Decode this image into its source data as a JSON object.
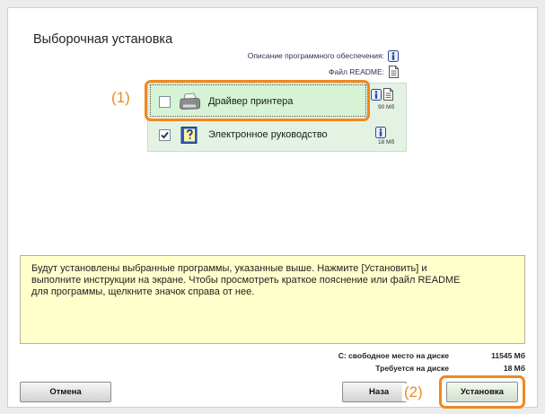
{
  "window": {
    "title": "Выборочная установка"
  },
  "legend": {
    "description_label": "Описание программного обеспечения:",
    "description_icon": "info-icon",
    "readme_label": "Файл README:",
    "readme_icon": "readme-icon"
  },
  "components": [
    {
      "name": "Драйвер принтера",
      "size": "90 Мб",
      "checked": false,
      "icon": "printer-icon",
      "highlighted": true
    },
    {
      "name": "Электронное руководство",
      "size": "18 Мб",
      "checked": true,
      "icon": "manual-icon",
      "highlighted": false
    }
  ],
  "annotations": {
    "step1": "(1)",
    "step2": "(2)"
  },
  "info_text": [
    "Будут установлены выбранные программы, указанные выше. Нажмите [Установить] и",
    "выполните инструкции на экране. Чтобы просмотреть краткое пояснение или файл README",
    "для программы, щелкните значок справа от нее."
  ],
  "disk": {
    "free_label": "C: свободное место на диске",
    "free_value": "11545 Мб",
    "required_label": "Требуется на диске",
    "required_value": "18 Мб"
  },
  "buttons": {
    "cancel": "Отмена",
    "back": "Наза",
    "install": "Установка"
  },
  "colors": {
    "highlight": "#f0881e",
    "note_background": "#ffffcc",
    "selected_row": "#d6f3d6",
    "list_background": "#e4f2e4"
  }
}
